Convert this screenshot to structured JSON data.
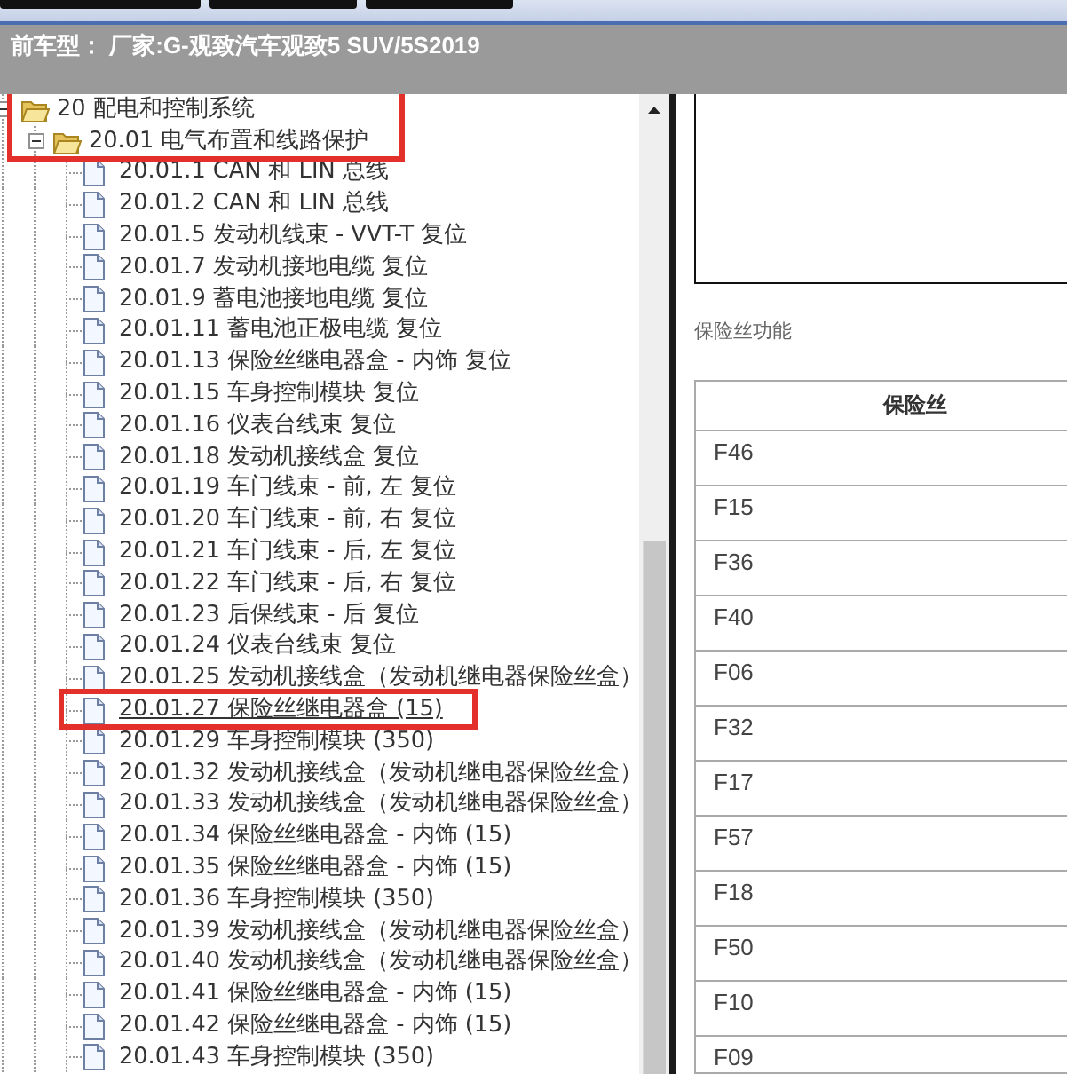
{
  "info_bar": {
    "text": "前车型： 厂家:G-观致汽车观致5 SUV/5S2019"
  },
  "tree": [
    {
      "label": "20 配电和控制系统",
      "expanded": true,
      "selected": false,
      "highlighted": true,
      "children": [
        {
          "label": "20.01 电气布置和线路保护",
          "expanded": true,
          "selected": false,
          "highlighted": true,
          "children": [
            {
              "label": "20.01.1 CAN 和 LIN 总线",
              "selected": false,
              "highlighted": false
            },
            {
              "label": "20.01.2 CAN 和 LIN 总线",
              "selected": false,
              "highlighted": false
            },
            {
              "label": "20.01.5 发动机线束 - VVT-T 复位",
              "selected": false,
              "highlighted": false
            },
            {
              "label": "20.01.7 发动机接地电缆 复位",
              "selected": false,
              "highlighted": false
            },
            {
              "label": "20.01.9 蓄电池接地电缆 复位",
              "selected": false,
              "highlighted": false
            },
            {
              "label": "20.01.11 蓄电池正极电缆 复位",
              "selected": false,
              "highlighted": false
            },
            {
              "label": "20.01.13 保险丝继电器盒 - 内饰 复位",
              "selected": false,
              "highlighted": false
            },
            {
              "label": "20.01.15 车身控制模块 复位",
              "selected": false,
              "highlighted": false
            },
            {
              "label": "20.01.16 仪表台线束 复位",
              "selected": false,
              "highlighted": false
            },
            {
              "label": "20.01.18 发动机接线盒 复位",
              "selected": false,
              "highlighted": false
            },
            {
              "label": "20.01.19 车门线束 - 前, 左 复位",
              "selected": false,
              "highlighted": false
            },
            {
              "label": "20.01.20 车门线束 - 前, 右 复位",
              "selected": false,
              "highlighted": false
            },
            {
              "label": "20.01.21 车门线束 - 后, 左 复位",
              "selected": false,
              "highlighted": false
            },
            {
              "label": "20.01.22 车门线束 - 后, 右 复位",
              "selected": false,
              "highlighted": false
            },
            {
              "label": "20.01.23 后保线束 - 后 复位",
              "selected": false,
              "highlighted": false
            },
            {
              "label": "20.01.24 仪表台线束 复位",
              "selected": false,
              "highlighted": false
            },
            {
              "label": "20.01.25 发动机接线盒（发动机继电器保险丝盒）",
              "selected": false,
              "highlighted": false
            },
            {
              "label": "20.01.27 保险丝继电器盒 (15)",
              "selected": true,
              "highlighted": true
            },
            {
              "label": "20.01.29 车身控制模块 (350)",
              "selected": false,
              "highlighted": false
            },
            {
              "label": "20.01.32 发动机接线盒（发动机继电器保险丝盒）",
              "selected": false,
              "highlighted": false
            },
            {
              "label": "20.01.33 发动机接线盒（发动机继电器保险丝盒）",
              "selected": false,
              "highlighted": false
            },
            {
              "label": "20.01.34 保险丝继电器盒 - 内饰 (15)",
              "selected": false,
              "highlighted": false
            },
            {
              "label": "20.01.35 保险丝继电器盒 - 内饰 (15)",
              "selected": false,
              "highlighted": false
            },
            {
              "label": "20.01.36 车身控制模块 (350)",
              "selected": false,
              "highlighted": false
            },
            {
              "label": "20.01.39 发动机接线盒（发动机继电器保险丝盒）",
              "selected": false,
              "highlighted": false
            },
            {
              "label": "20.01.40 发动机接线盒（发动机继电器保险丝盒）",
              "selected": false,
              "highlighted": false
            },
            {
              "label": "20.01.41 保险丝继电器盒 - 内饰 (15)",
              "selected": false,
              "highlighted": false
            },
            {
              "label": "20.01.42 保险丝继电器盒 - 内饰 (15)",
              "selected": false,
              "highlighted": false
            },
            {
              "label": "20.01.43 车身控制模块 (350)",
              "selected": false,
              "highlighted": false
            }
          ]
        }
      ]
    }
  ],
  "content": {
    "caption": "保险丝功能",
    "fuse_table": {
      "columns": [
        "保险丝"
      ],
      "rows": [
        [
          "F46"
        ],
        [
          "F15"
        ],
        [
          "F36"
        ],
        [
          "F40"
        ],
        [
          "F06"
        ],
        [
          "F32"
        ],
        [
          "F17"
        ],
        [
          "F57"
        ],
        [
          "F18"
        ],
        [
          "F50"
        ],
        [
          "F10"
        ],
        [
          "F09"
        ]
      ]
    }
  }
}
